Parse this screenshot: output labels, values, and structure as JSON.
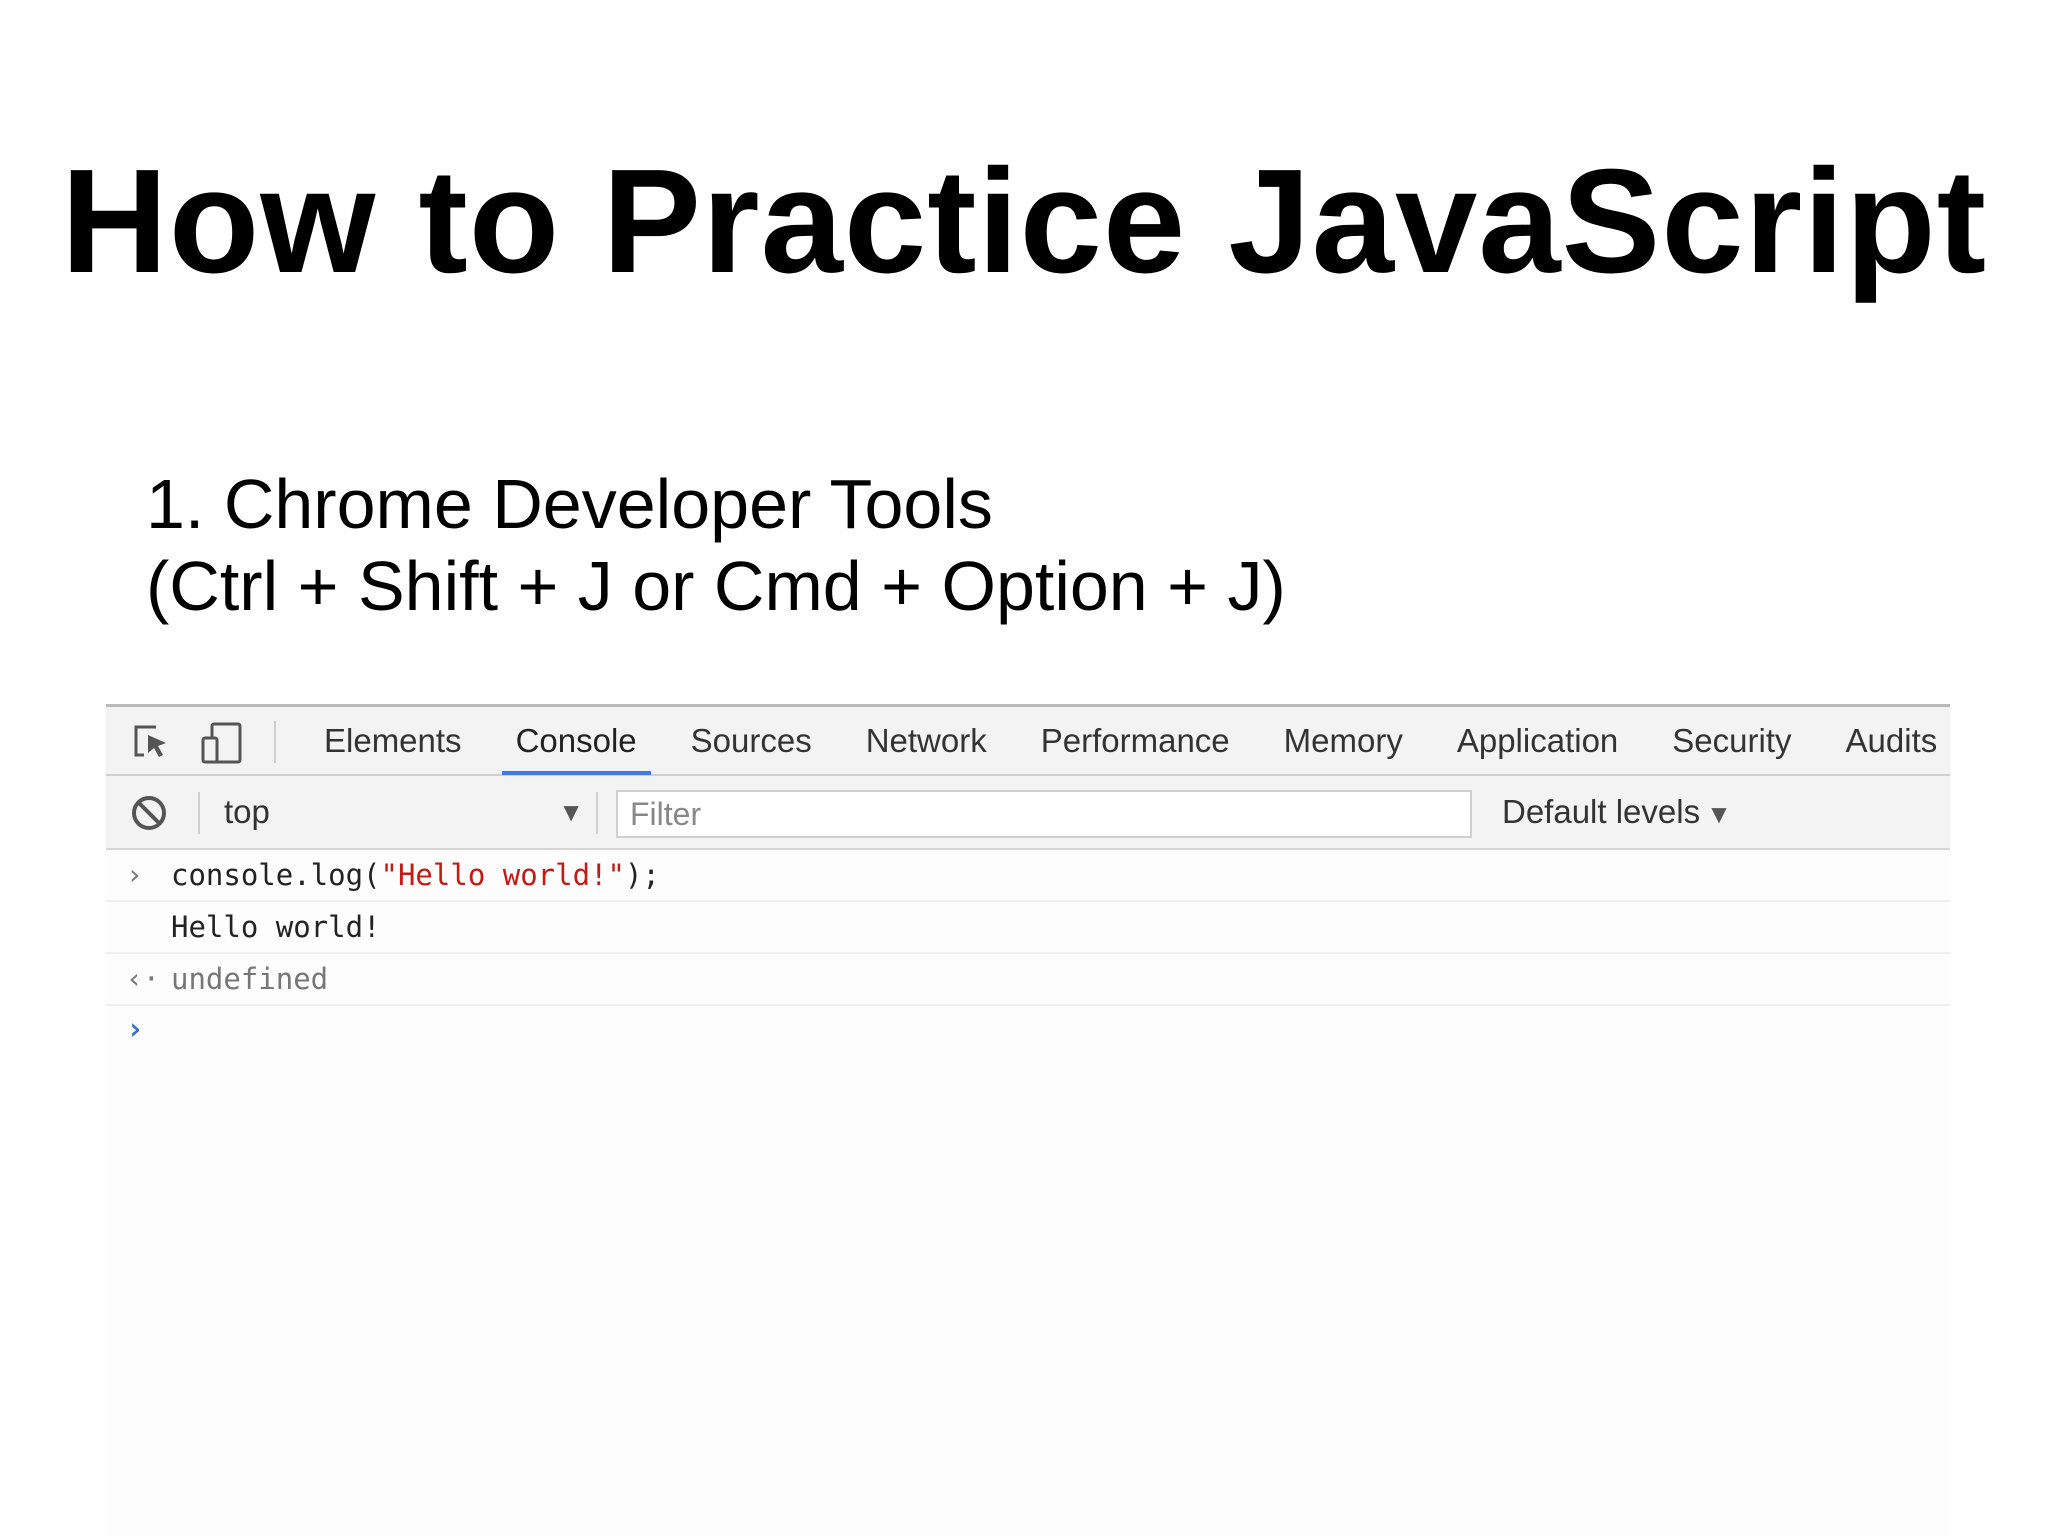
{
  "slide": {
    "title": "How to Practice JavaScript",
    "subtitle_line1": "1. Chrome Developer Tools",
    "subtitle_line2": "(Ctrl + Shift + J or Cmd + Option + J)"
  },
  "devtools": {
    "toolbar_icons": [
      "inspect-element-icon",
      "device-toolbar-icon"
    ],
    "tabs": [
      "Elements",
      "Console",
      "Sources",
      "Network",
      "Performance",
      "Memory",
      "Application",
      "Security",
      "Audits"
    ],
    "active_tab": "Console",
    "accent_color": "#3b7ce8",
    "filterbar": {
      "clear_icon": "clear-console-icon",
      "context": "top",
      "context_arrow": "▼",
      "filter_placeholder": "Filter",
      "filter_value": "",
      "levels_label": "Default levels",
      "levels_arrow": "▼"
    },
    "console": {
      "input_gutter": "›",
      "input_prefix": "console.log(",
      "input_string": "\"Hello world!\"",
      "input_suffix": ");",
      "output_text": "Hello world!",
      "result_gutter": "‹·",
      "result_text": "undefined",
      "prompt_gutter": "›",
      "string_color": "#c41a16"
    }
  }
}
